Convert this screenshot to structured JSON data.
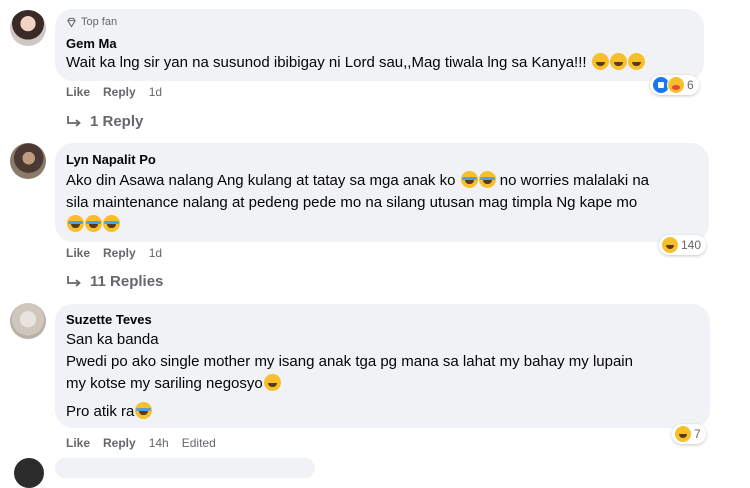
{
  "comments": [
    {
      "badge": "Top fan",
      "author": "Gem Ma",
      "lines": [
        "Wait ka lng sir yan na susunod ibibigay ni Lord sau,,Mag tiwala lng sa Kanya!!!"
      ],
      "actions": {
        "like": "Like",
        "reply": "Reply",
        "time": "1d"
      },
      "reaction_count": "6",
      "replies": "1 Reply"
    },
    {
      "author": "Lyn Napalit Po",
      "lines": [
        "Ako din Asawa nalang Ang kulang at tatay sa mga anak ko",
        "no worries malalaki na",
        "sila maintenance nalang at pedeng pede mo na silang utusan mag timpla Ng kape mo"
      ],
      "actions": {
        "like": "Like",
        "reply": "Reply",
        "time": "1d"
      },
      "reaction_count": "140",
      "replies": "11 Replies"
    },
    {
      "author": "Suzette Teves",
      "lines": [
        "San ka banda",
        "Pwedi po ako single mother my isang anak tga pg mana sa lahat my bahay my lupain",
        "my kotse my sariling negosyo",
        "Pro atik ra"
      ],
      "actions": {
        "like": "Like",
        "reply": "Reply",
        "time": "14h",
        "edited": "Edited"
      },
      "reaction_count": "7"
    }
  ],
  "icons": {
    "top_fan": "diamond-icon",
    "reply_arrow": "reply-arrow-icon",
    "like_reaction": "like-reaction-icon",
    "care_reaction": "care-reaction-icon",
    "haha_reaction": "haha-reaction-icon"
  },
  "colors": {
    "bubble": "#f0f2f5",
    "secondary_text": "#65676b",
    "like_blue": "#1877f2",
    "emoji_yellow": "#f7c02b"
  }
}
